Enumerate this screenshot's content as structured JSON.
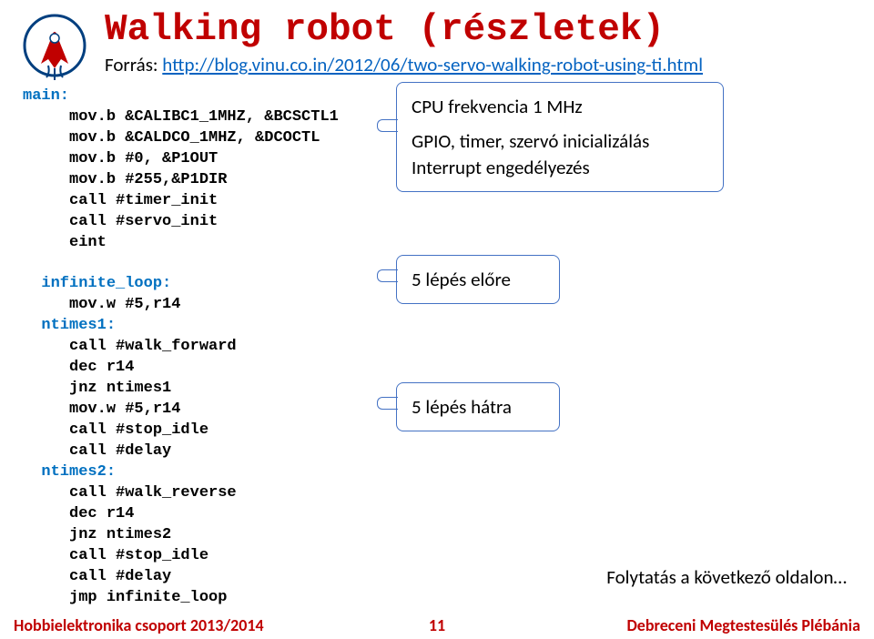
{
  "title": "Walking robot (részletek)",
  "source_prefix": "Forrás: ",
  "source_url": "http://blog.vinu.co.in/2012/06/two-servo-walking-robot-using-ti.html",
  "code": {
    "l1": "main:",
    "l2": "     mov.b &CALIBC1_1MHZ, &BCSCTL1",
    "l3": "     mov.b &CALDCO_1MHZ, &DCOCTL",
    "l4": "     mov.b #0, &P1OUT",
    "l5": "     mov.b #255,&P1DIR",
    "l6": "     call #timer_init",
    "l7": "     call #servo_init",
    "l8": "     eint",
    "l9": "",
    "l10": "  infinite_loop:",
    "l11": "     mov.w #5,r14",
    "l12": "  ntimes1:",
    "l13": "     call #walk_forward",
    "l14": "     dec r14",
    "l15": "     jnz ntimes1",
    "l16": "     mov.w #5,r14",
    "l17": "     call #stop_idle",
    "l18": "     call #delay",
    "l19": "  ntimes2:",
    "l20": "     call #walk_reverse",
    "l21": "     dec r14",
    "l22": "     jnz ntimes2",
    "l23": "     call #stop_idle",
    "l24": "     call #delay",
    "l25": "     jmp infinite_loop"
  },
  "annotations": {
    "box1_l1": "CPU frekvencia 1 MHz",
    "box1_l2": "GPIO, timer, szervó inicializálás",
    "box1_l3": "Interrupt engedélyezés",
    "box2": "5 lépés előre",
    "box3": "5 lépés hátra"
  },
  "continuation": "Folytatás a következő oldalon…",
  "footer": {
    "left": "Hobbielektronika csoport 2013/2014",
    "center": "11",
    "right": "Debreceni Megtestesülés Plébánia"
  }
}
